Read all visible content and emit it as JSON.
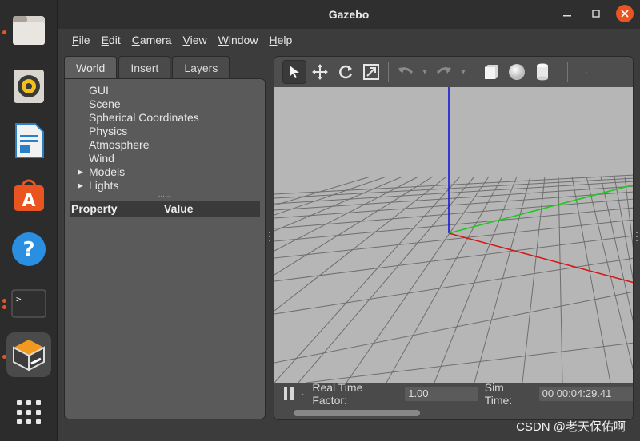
{
  "window": {
    "title": "Gazebo"
  },
  "menu": [
    "File",
    "Edit",
    "Camera",
    "View",
    "Window",
    "Help"
  ],
  "menu_underline": [
    "F",
    "E",
    "C",
    "V",
    "W",
    "H"
  ],
  "tabs": [
    "World",
    "Insert",
    "Layers"
  ],
  "tree": [
    "GUI",
    "Scene",
    "Spherical Coordinates",
    "Physics",
    "Atmosphere",
    "Wind",
    "Models",
    "Lights"
  ],
  "properties": {
    "col1": "Property",
    "col2": "Value"
  },
  "sim": {
    "rtf_label": "Real Time Factor:",
    "rtf_value": "1.00",
    "simtime_label": "Sim Time:",
    "simtime_value": "00 00:04:29.41"
  },
  "watermark": "CSDN @老天保佑啊",
  "colors": {
    "accent": "#e95420"
  },
  "toolbar_icons": [
    "select-arrow-icon",
    "translate-icon",
    "rotate-icon",
    "scale-icon",
    "undo-icon",
    "redo-icon",
    "box-icon",
    "sphere-icon",
    "cylinder-icon"
  ],
  "dock_icons": [
    "files-icon",
    "rhythmbox-icon",
    "writer-icon",
    "software-icon",
    "help-icon",
    "terminal-icon",
    "gazebo-icon",
    "app-grid-icon"
  ]
}
